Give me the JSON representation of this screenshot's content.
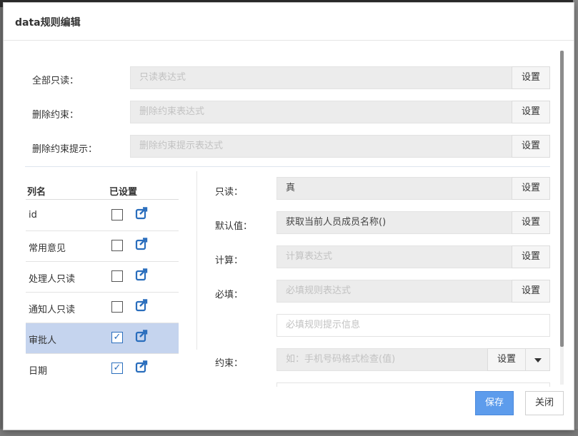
{
  "dialog": {
    "title": "data规则编辑"
  },
  "top_rows": [
    {
      "label": "全部只读：",
      "placeholder": "只读表达式",
      "button": "设置"
    },
    {
      "label": "删除约束：",
      "placeholder": "删除约束表达式",
      "button": "设置"
    },
    {
      "label": "删除约束提示：",
      "placeholder": "删除约束提示表达式",
      "button": "设置"
    }
  ],
  "columns": {
    "header_name": "列名",
    "header_set": "已设置",
    "items": [
      {
        "name": "id",
        "checked": false,
        "selected": false
      },
      {
        "name": "常用意见",
        "checked": false,
        "selected": false
      },
      {
        "name": "处理人只读",
        "checked": false,
        "selected": false
      },
      {
        "name": "通知人只读",
        "checked": false,
        "selected": false
      },
      {
        "name": "审批人",
        "checked": true,
        "selected": true
      },
      {
        "name": "日期",
        "checked": true,
        "selected": false
      }
    ]
  },
  "rules": {
    "readonly": {
      "label": "只读：",
      "value": "真",
      "button": "设置"
    },
    "default": {
      "label": "默认值：",
      "value": "获取当前人员成员名称()",
      "button": "设置"
    },
    "compute": {
      "label": "计算：",
      "placeholder": "计算表达式",
      "button": "设置"
    },
    "required": {
      "label": "必填：",
      "placeholder": "必填规则表达式",
      "button": "设置"
    },
    "required_hint": {
      "placeholder": "必填规则提示信息"
    },
    "constraint": {
      "label": "约束：",
      "placeholder": "如：手机号码格式检查(值)",
      "button": "设置"
    }
  },
  "footer": {
    "save": "保存",
    "close": "关闭"
  },
  "colors": {
    "primary": "#5d9cec",
    "selected_row": "#c5d4ee",
    "icon": "#2a6ebd"
  }
}
